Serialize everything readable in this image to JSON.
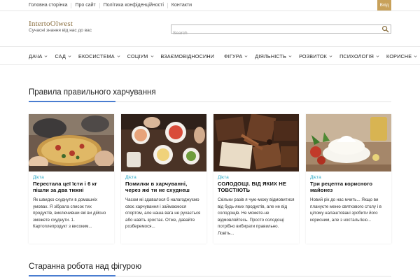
{
  "topnav": {
    "items": [
      "Головна сторінка",
      "Про сайт",
      "Політика конфіденційності",
      "Контакти"
    ],
    "login": "Вхід"
  },
  "site": {
    "logo": "IntertoOlwest",
    "tagline": "Сучасні знання від нас до вас"
  },
  "search": {
    "placeholder": "Search"
  },
  "mainnav": {
    "items": [
      {
        "label": "ДАЧА",
        "dropdown": true
      },
      {
        "label": "САД",
        "dropdown": true
      },
      {
        "label": "ЕКОСИСТЕМА",
        "dropdown": true
      },
      {
        "label": "СОЦІУМ",
        "dropdown": true
      },
      {
        "label": "ВЗАЄМОВІДНОСИНИ",
        "dropdown": false
      },
      {
        "label": "ФІГУРА",
        "dropdown": true
      },
      {
        "label": "ДІЯЛЬНІСТЬ",
        "dropdown": true
      },
      {
        "label": "РОЗВИТОК",
        "dropdown": true
      },
      {
        "label": "ПСИХОЛОГІЯ",
        "dropdown": true
      },
      {
        "label": "КОРИСНЕ",
        "dropdown": true
      }
    ]
  },
  "sections": [
    {
      "title": "Правила правильного харчування"
    },
    {
      "title": "Старанна робота над фігурою"
    }
  ],
  "cards": [
    {
      "category": "Дієта",
      "title": "Перестала цеї їсти і 6 кг пішли за два тижні",
      "excerpt": "Як швидко схуднути в домашніх умовах. Я зібрала список тих продуктів, виключивши які ви дійсно зможете схуднути. 1. Картоплепродукт з високим..."
    },
    {
      "category": "Дієта",
      "title": "Помилки в харчуванні, через які ти не схуднеш",
      "excerpt": "Часом мі здавалося б налагоджуємо своє харчування і займаємося спортом, але наша вага не рухається або навіть зростає. Отже, давайте розберемося..."
    },
    {
      "category": "Дієта",
      "title": "СОЛОДОЩІ. ВІД ЯКИХ НЕ ТОВСТІЮТЬ",
      "excerpt": "Скільки разів я чую-можу відмовитися від будь-яких продуктів, але не від солодощів. Не можете-не відмовляйтесь. Просто солодощі потрібно вибирати правильно. Ловіть..."
    },
    {
      "category": "Дієта",
      "title": "Три рецепта корисного майонез",
      "excerpt": "Новий рік до нас мчить... Якщо ви плануєте меню святкового столу і в цілому налаштовані зробити його корисним, але з ностальгією..."
    }
  ]
}
